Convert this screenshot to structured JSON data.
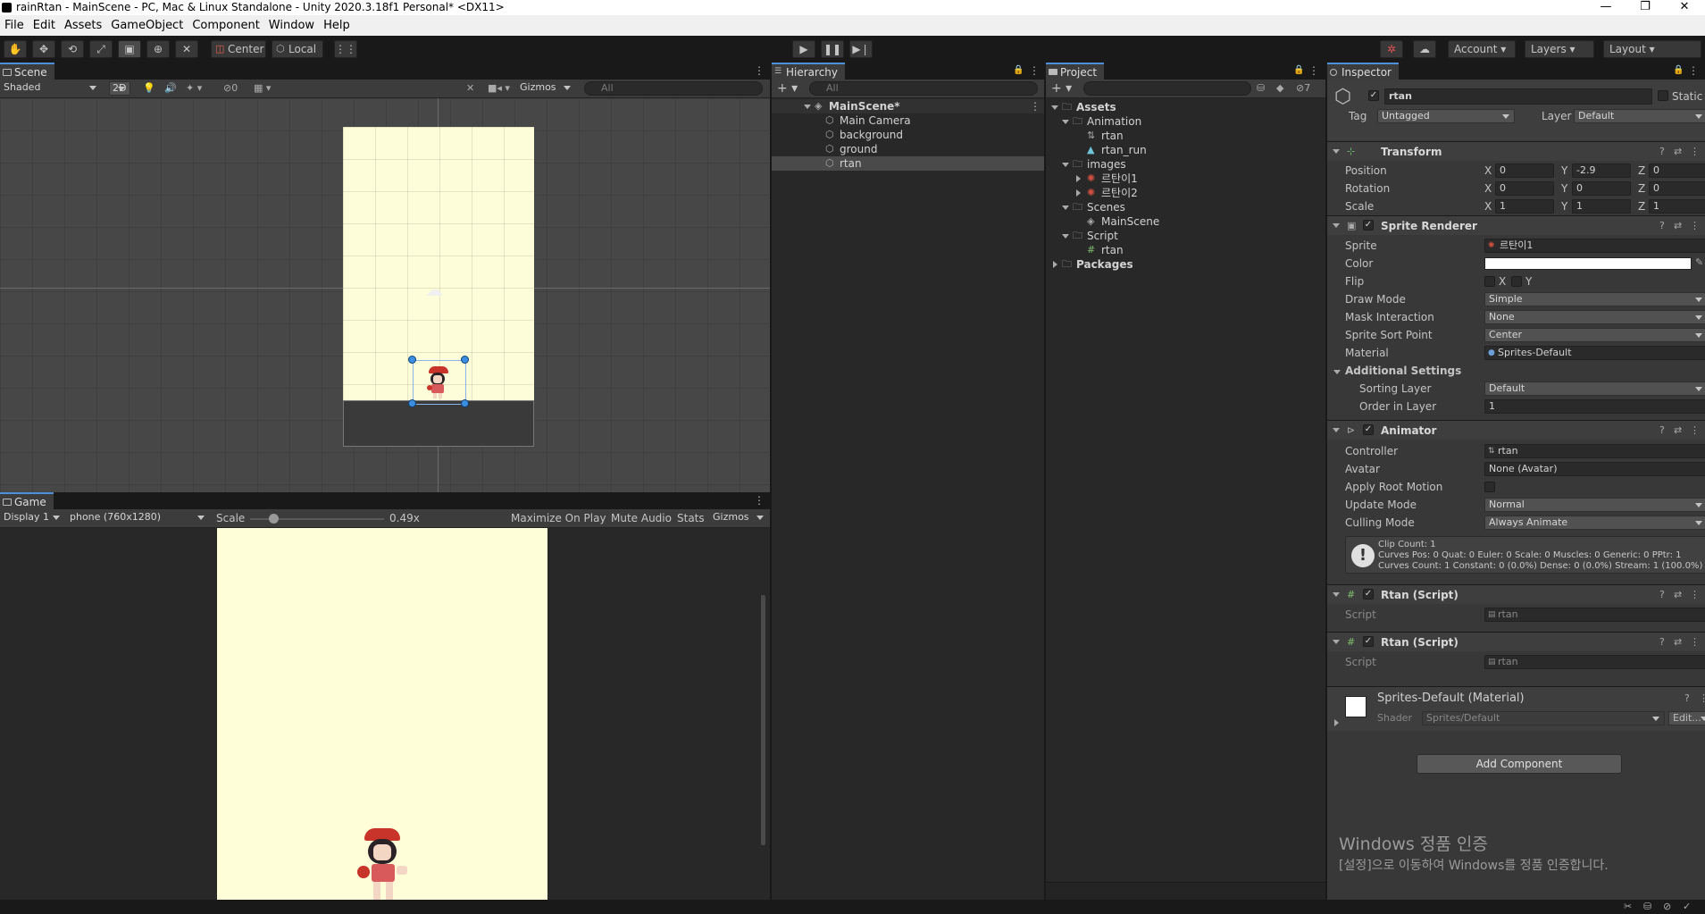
{
  "window": {
    "title": "rainRtan - MainScene - PC, Mac & Linux Standalone - Unity 2020.3.18f1 Personal* <DX11>",
    "min": "—",
    "max": "❐",
    "close": "✕"
  },
  "menu": [
    "File",
    "Edit",
    "Assets",
    "GameObject",
    "Component",
    "Window",
    "Help"
  ],
  "toolbar": {
    "pivot": "Center",
    "space": "Local",
    "account": "Account",
    "layers": "Layers",
    "layout": "Layout"
  },
  "scene": {
    "tab": "Scene",
    "shading": "Shaded",
    "mode2d": "2D",
    "hidden_count": "0",
    "gizmos": "Gizmos",
    "search_placeholder": "All"
  },
  "game": {
    "tab": "Game",
    "display": "Display 1",
    "resolution": "phone (760x1280)",
    "scale_label": "Scale",
    "scale_value": "0.49x",
    "maximize": "Maximize On Play",
    "mute": "Mute Audio",
    "stats": "Stats",
    "gizmos": "Gizmos"
  },
  "hierarchy": {
    "tab": "Hierarchy",
    "search_placeholder": "All",
    "scene": "MainScene*",
    "items": [
      "Main Camera",
      "background",
      "ground",
      "rtan"
    ]
  },
  "project": {
    "tab": "Project",
    "hidden_count": "7",
    "tree": [
      {
        "label": "Assets",
        "bold": true
      },
      {
        "label": "Animation"
      },
      {
        "label": "rtan"
      },
      {
        "label": "rtan_run"
      },
      {
        "label": "images"
      },
      {
        "label": "르탄이1"
      },
      {
        "label": "르탄이2"
      },
      {
        "label": "Scenes"
      },
      {
        "label": "MainScene"
      },
      {
        "label": "Script"
      },
      {
        "label": "rtan"
      },
      {
        "label": "Packages",
        "bold": true
      }
    ]
  },
  "inspector": {
    "tab": "Inspector",
    "object_name": "rtan",
    "static": "Static",
    "tag_label": "Tag",
    "tag": "Untagged",
    "layer_label": "Layer",
    "layer": "Default",
    "transform": {
      "title": "Transform",
      "position_label": "Position",
      "position": {
        "x": "0",
        "y": "-2.9",
        "z": "0"
      },
      "rotation_label": "Rotation",
      "rotation": {
        "x": "0",
        "y": "0",
        "z": "0"
      },
      "scale_label": "Scale",
      "scale": {
        "x": "1",
        "y": "1",
        "z": "1"
      },
      "axis_x": "X",
      "axis_y": "Y",
      "axis_z": "Z"
    },
    "sprite_renderer": {
      "title": "Sprite Renderer",
      "sprite_label": "Sprite",
      "sprite": "르탄이1",
      "color_label": "Color",
      "color": "#ffffff",
      "flip_label": "Flip",
      "flip_x": "X",
      "flip_y": "Y",
      "draw_mode_label": "Draw Mode",
      "draw_mode": "Simple",
      "mask_label": "Mask Interaction",
      "mask": "None",
      "sort_point_label": "Sprite Sort Point",
      "sort_point": "Center",
      "material_label": "Material",
      "material": "Sprites-Default",
      "additional": "Additional Settings",
      "sorting_layer_label": "Sorting Layer",
      "sorting_layer": "Default",
      "order_label": "Order in Layer",
      "order": "1"
    },
    "animator": {
      "title": "Animator",
      "controller_label": "Controller",
      "controller": "rtan",
      "avatar_label": "Avatar",
      "avatar": "None (Avatar)",
      "root_motion_label": "Apply Root Motion",
      "update_mode_label": "Update Mode",
      "update_mode": "Normal",
      "culling_label": "Culling Mode",
      "culling": "Always Animate",
      "info": [
        "Clip Count: 1",
        "Curves Pos: 0 Quat: 0 Euler: 0 Scale: 0 Muscles: 0 Generic: 0 PPtr: 1",
        "Curves Count: 1 Constant: 0 (0.0%) Dense: 0 (0.0%) Stream: 1 (100.0%)"
      ]
    },
    "script1": {
      "title": "Rtan (Script)",
      "script_label": "Script",
      "script": "rtan"
    },
    "script2": {
      "title": "Rtan (Script)",
      "script_label": "Script",
      "script": "rtan"
    },
    "material": {
      "title": "Sprites-Default (Material)",
      "shader_label": "Shader",
      "shader": "Sprites/Default",
      "edit": "Edit..."
    },
    "add_component": "Add Component"
  },
  "watermark": {
    "line1": "Windows 정품 인증",
    "line2": "[설정]으로 이동하여 Windows를 정품 인증합니다."
  }
}
